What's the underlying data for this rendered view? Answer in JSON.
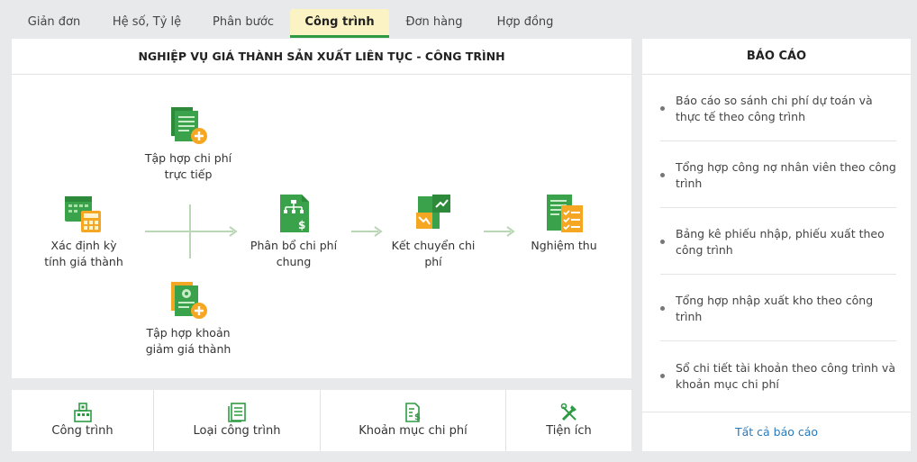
{
  "tabs": [
    {
      "label": "Giản đơn"
    },
    {
      "label": "Hệ số, Tỷ lệ"
    },
    {
      "label": "Phân bước"
    },
    {
      "label": "Công trình"
    },
    {
      "label": "Đơn hàng"
    },
    {
      "label": "Hợp đồng"
    }
  ],
  "flow": {
    "title": "NGHIỆP VỤ GIÁ THÀNH SẢN XUẤT LIÊN TỤC - CÔNG TRÌNH",
    "nodes": {
      "ky_tinh": {
        "label": "Xác định kỳ tính giá thành"
      },
      "tap_hop_truc_tiep": {
        "label": "Tập hợp chi phí trực tiếp"
      },
      "tap_hop_giam": {
        "label": "Tập hợp khoản giảm giá thành"
      },
      "phan_bo": {
        "label": "Phân bổ chi phí chung"
      },
      "ket_chuyen": {
        "label": "Kết chuyển chi phí"
      },
      "nghiem_thu": {
        "label": "Nghiệm thu"
      }
    }
  },
  "reports": {
    "title": "BÁO CÁO",
    "items": [
      {
        "label": "Báo cáo so sánh chi phí dự toán và thực tế theo công trình"
      },
      {
        "label": "Tổng hợp công nợ nhân viên theo công trình"
      },
      {
        "label": "Bảng kê phiếu nhập, phiếu xuất theo công trình"
      },
      {
        "label": "Tổng hợp nhập xuất kho theo công trình"
      },
      {
        "label": "Sổ chi tiết tài khoản theo công trình và khoản mục chi phí"
      }
    ],
    "all_label": "Tất cả báo cáo"
  },
  "shortcuts": [
    {
      "label": "Công trình",
      "icon": "building-icon"
    },
    {
      "label": "Loại công trình",
      "icon": "document-list-icon"
    },
    {
      "label": "Khoản mục chi phí",
      "icon": "cost-document-icon"
    },
    {
      "label": "Tiện ích",
      "icon": "tools-icon"
    }
  ],
  "colors": {
    "accent": "#2e9b44",
    "active_tab_bg": "#fbf3c4",
    "link": "#2a7ab8",
    "icon_orange": "#f5a623"
  }
}
